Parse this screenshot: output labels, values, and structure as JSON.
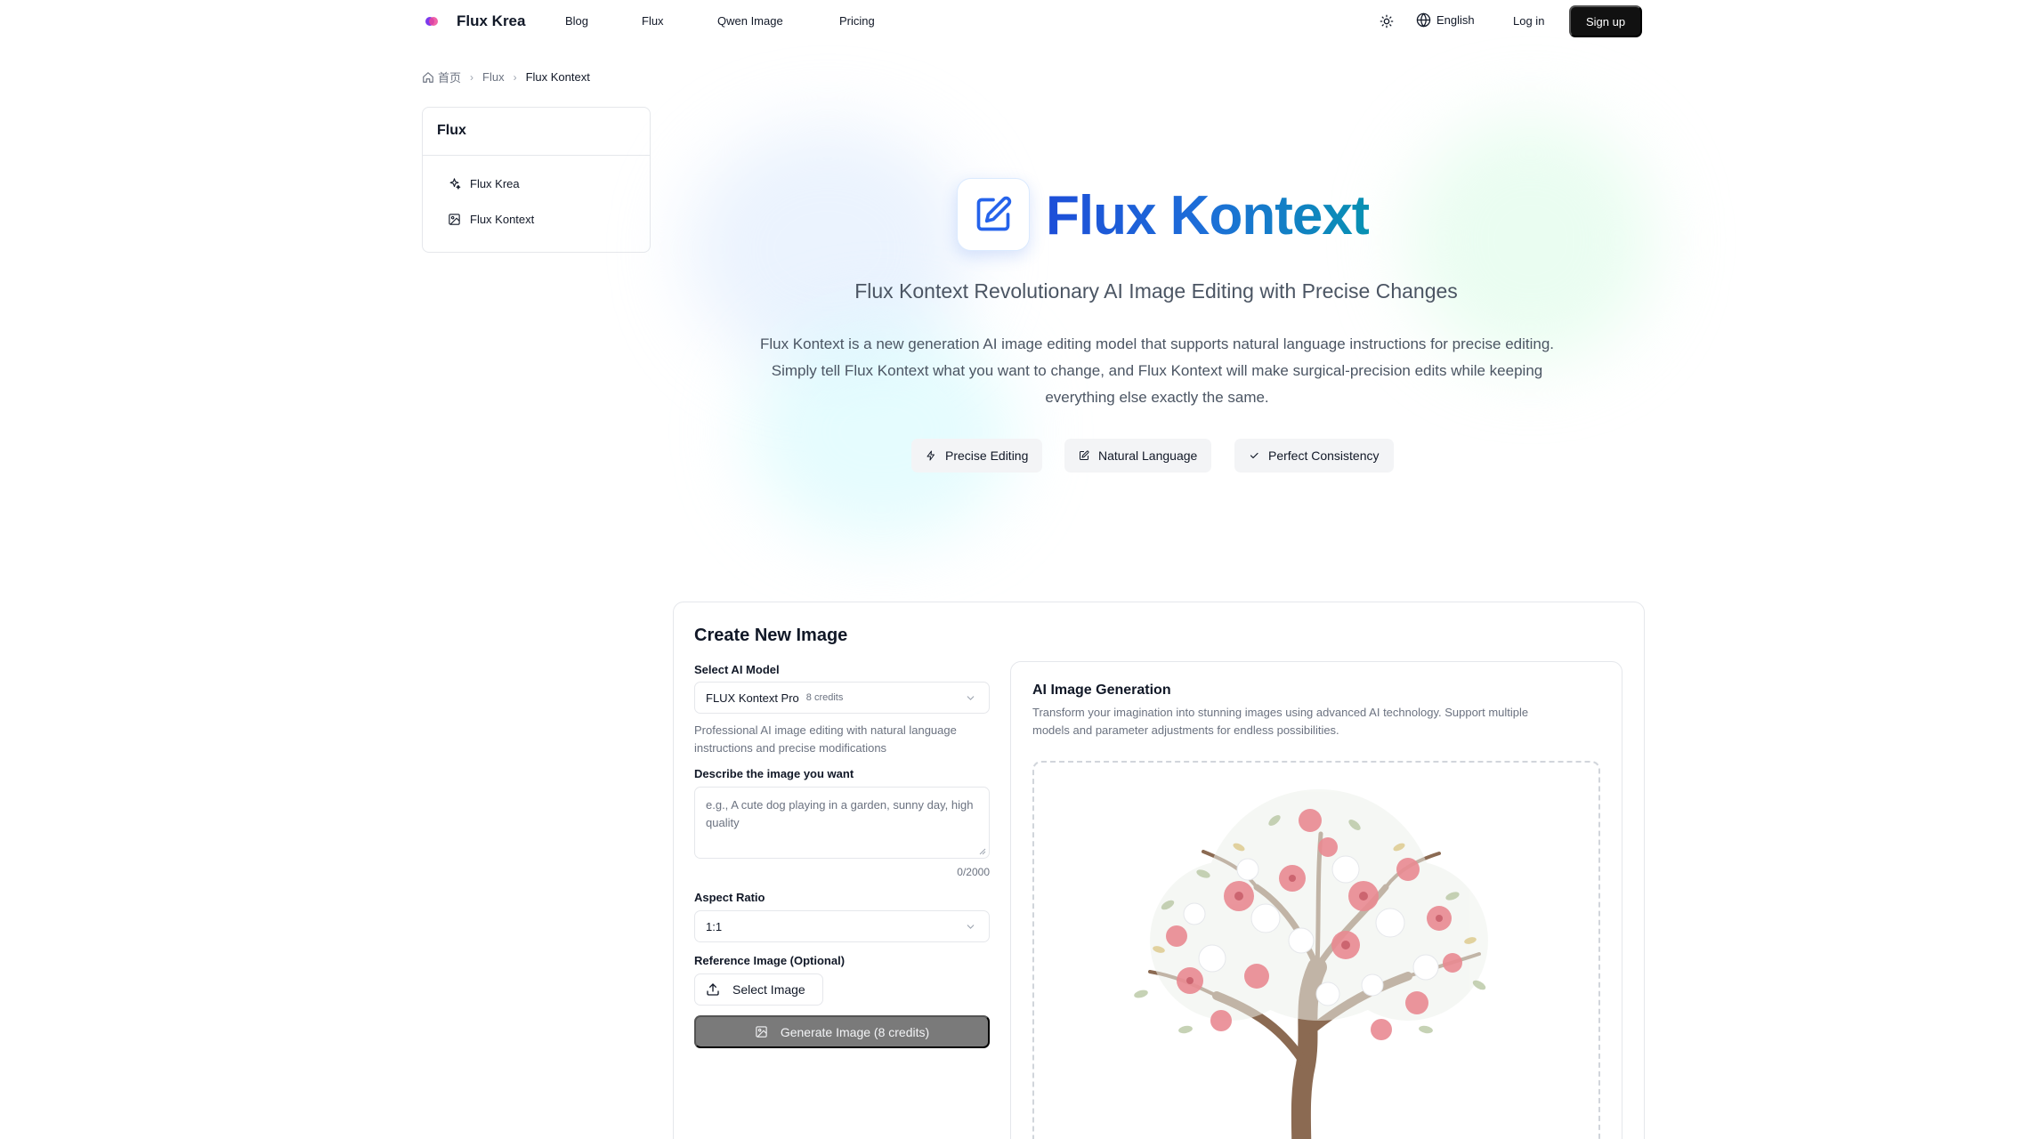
{
  "brand": {
    "name": "Flux Krea",
    "logo_tiny": "Flux Krea"
  },
  "nav": {
    "blog": "Blog",
    "flux": "Flux",
    "qwen": "Qwen Image",
    "pricing": "Pricing"
  },
  "header": {
    "language": "English",
    "login": "Log in",
    "signup": "Sign up"
  },
  "breadcrumb": {
    "home": "首页",
    "parent": "Flux",
    "current": "Flux Kontext"
  },
  "sidebar": {
    "title": "Flux",
    "items": [
      {
        "label": "Flux Krea",
        "icon": "sparkles-icon"
      },
      {
        "label": "Flux Kontext",
        "icon": "image-icon"
      }
    ]
  },
  "hero": {
    "title": "Flux Kontext",
    "subtitle": "Flux Kontext Revolutionary AI Image Editing with Precise Changes",
    "description_lines": [
      "Flux Kontext is a new generation AI image editing model that supports natural language instructions for precise editing.",
      "Simply tell Flux Kontext what you want to change, and Flux Kontext will make surgical-precision edits while keeping",
      "everything else exactly the same."
    ],
    "chips": [
      "Precise Editing",
      "Natural Language",
      "Perfect Consistency"
    ]
  },
  "create": {
    "title": "Create New Image",
    "model_label": "Select AI Model",
    "model_value": "FLUX Kontext Pro",
    "model_credits": "8 credits",
    "model_help_lines": [
      "Professional AI image editing with natural language",
      "instructions and precise modifications"
    ],
    "prompt_label": "Describe the image you want",
    "prompt_placeholder": "e.g., A cute dog playing in a garden, sunny day, high quality",
    "prompt_counter": "0/2000",
    "aspect_label": "Aspect Ratio",
    "aspect_value": "1:1",
    "reference_label": "Reference Image (Optional)",
    "select_image": "Select Image",
    "generate": "Generate Image (8 credits)"
  },
  "preview": {
    "title": "AI Image Generation",
    "description_lines": [
      "Transform your imagination into stunning images using advanced AI technology. Support multiple",
      "models and parameter adjustments for endless possibilities."
    ]
  },
  "colors": {
    "accent_gradient_start": "#1d4ed8",
    "accent_gradient_end": "#0891b2",
    "primary_button": "#111111",
    "disabled_button": "#7a7a7a",
    "blossom_pink": "#e98a92",
    "trunk_brown": "#8b6a52"
  }
}
